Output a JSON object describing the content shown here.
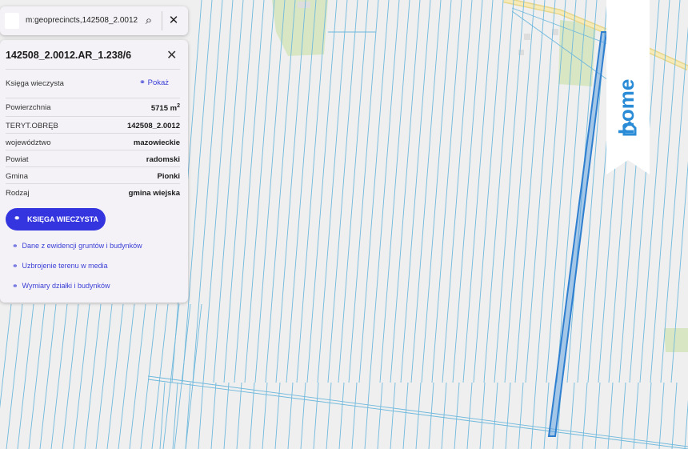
{
  "search": {
    "query": "m:geoprecincts,142508_2.0012",
    "search_icon": "search-icon",
    "close_icon": "close-icon"
  },
  "panel": {
    "title": "142508_2.0012.AR_1.238/6",
    "kw_label": "Księga wieczysta",
    "kw_link": "Pokaż",
    "rows": [
      {
        "label": "Powierzchnia",
        "value": "5715 m",
        "sup": "2"
      },
      {
        "label": "TERYT.OBRĘB",
        "value": "142508_2.0012"
      },
      {
        "label": "województwo",
        "value": "mazowieckie"
      },
      {
        "label": "Powiat",
        "value": "radomski"
      },
      {
        "label": "Gmina",
        "value": "Pionki"
      },
      {
        "label": "Rodzaj",
        "value": "gmina wiejska"
      }
    ],
    "button_label": "KSIĘGA WIECZYSTA",
    "links": [
      "Dane z ewidencji gruntów i budynków",
      "Uzbrojenie terenu w media",
      "Wymiary działki i budynków"
    ]
  },
  "brand": {
    "text": "home",
    "color": "#2a8bd6"
  },
  "colors": {
    "parcel_line": "#6fb9dd",
    "highlight": "#2f7fd0",
    "road": "#f2e3a0",
    "green": "#d8e6c4"
  }
}
